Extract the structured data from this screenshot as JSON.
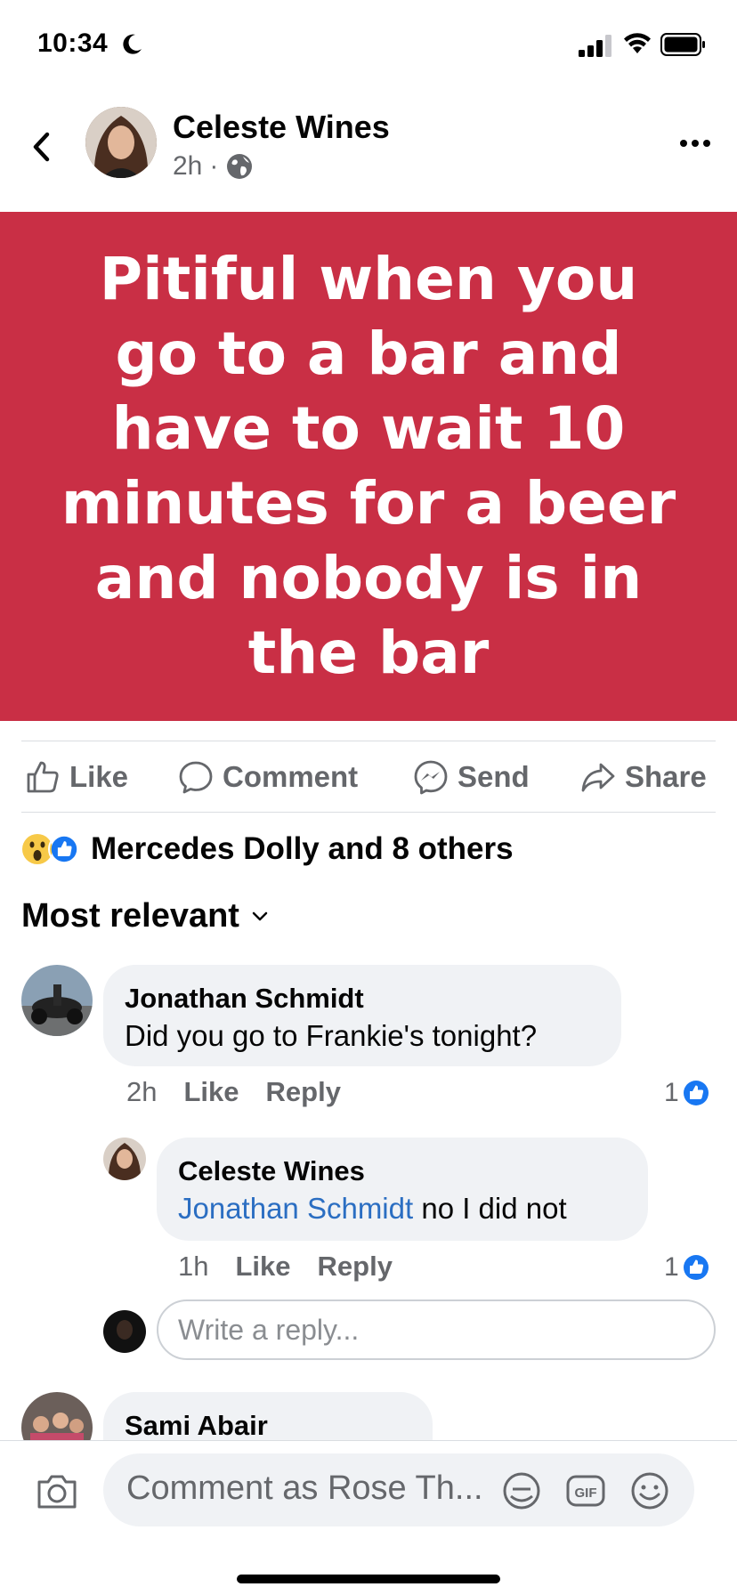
{
  "status_bar": {
    "time": "10:34"
  },
  "post": {
    "author": "Celeste Wines",
    "time": "2h",
    "separator": "·",
    "text": "Pitiful when you go to a bar and have to wait 10 minutes for a beer and nobody is in the bar",
    "background_color": "#c92f45"
  },
  "actions": {
    "like": "Like",
    "comment": "Comment",
    "send": "Send",
    "share": "Share"
  },
  "reactions": {
    "summary": "Mercedes Dolly and 8 others",
    "icons": [
      "wow-icon",
      "like-icon"
    ]
  },
  "sort": {
    "label": "Most relevant"
  },
  "comments": [
    {
      "name": "Jonathan Schmidt",
      "text": "Did you go to Frankie's tonight?",
      "time": "2h",
      "like": "Like",
      "reply": "Reply",
      "likes": "1",
      "replies": [
        {
          "name": "Celeste Wines",
          "mention": "Jonathan Schmidt",
          "text": " no I did not",
          "time": "1h",
          "like": "Like",
          "reply": "Reply",
          "likes": "1"
        }
      ]
    },
    {
      "name": "Sami Abair"
    }
  ],
  "reply_input": {
    "placeholder": "Write a reply..."
  },
  "comment_bar": {
    "placeholder": "Comment as Rose Th..."
  }
}
